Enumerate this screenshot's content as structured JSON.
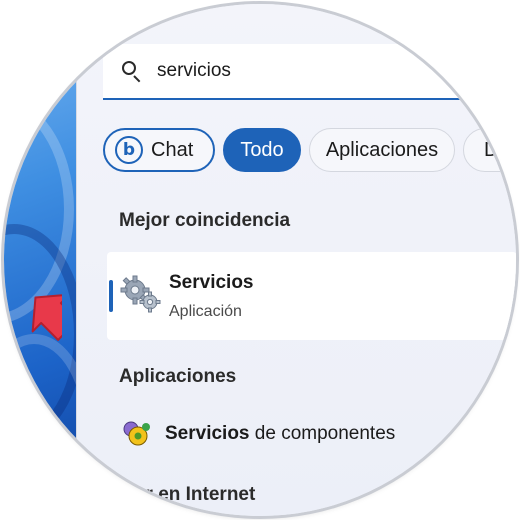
{
  "search": {
    "value": "servicios",
    "icon": "search-icon"
  },
  "filters": {
    "chat_label": "Chat",
    "todo_label": "Todo",
    "apps_label": "Aplicaciones",
    "docs_label": "D"
  },
  "sections": {
    "best_match_title": "Mejor coincidencia",
    "apps_title": "Aplicaciones",
    "web_title": "rcar en Internet"
  },
  "best_match": {
    "title": "Servicios",
    "subtitle": "Aplicación",
    "icon": "gears-icon"
  },
  "apps": [
    {
      "bold": "Servicios",
      "rest": " de componentes",
      "icon": "component-services-icon"
    }
  ],
  "colors": {
    "accent": "#1e63b8",
    "arrow": "#e8394a"
  }
}
